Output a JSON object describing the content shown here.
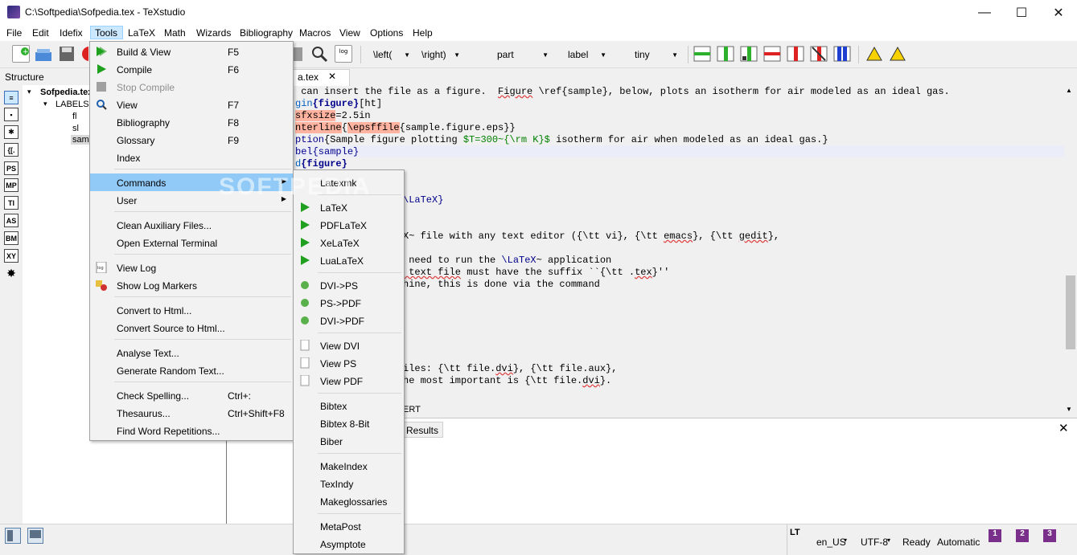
{
  "window": {
    "title": "C:\\Softpedia\\Sofpedia.tex - TeXstudio",
    "minimize": "—",
    "maximize": "☐",
    "close": "✕"
  },
  "menubar": [
    "File",
    "Edit",
    "Idefix",
    "Tools",
    "LaTeX",
    "Math",
    "Wizards",
    "Bibliography",
    "Macros",
    "View",
    "Options",
    "Help"
  ],
  "toolbar": {
    "combos": [
      "\\left(",
      "\\right)",
      "part",
      "label",
      "tiny"
    ]
  },
  "structure": {
    "header": "Structure",
    "sidebar_icons": [
      "≡",
      "▪",
      "✱",
      "{[.",
      "PS",
      "MP",
      "TI",
      "AS",
      "BM",
      "XY",
      "✸"
    ],
    "tree": {
      "root": "Sofpedia.tex",
      "labels": "LABELS",
      "items": [
        "fl",
        "sl",
        "samp"
      ]
    }
  },
  "editor": {
    "tab_name": "Sofpedia.tex",
    "tab_visible": "a.tex",
    "tab_close": "✕",
    "watermark": "SOFTPEDIA",
    "line_frag_1": " can insert the file as a figure.  ",
    "line_frag_1b": "Figure",
    "line_frag_1c": " \\ref{sample}, below, plots an isotherm for air modeled as an ideal gas.",
    "line_frag_2a": "gin",
    "line_frag_2b": "{figure}",
    "line_frag_2c": "[ht]",
    "line_frag_3a": "sfxsize",
    "line_frag_3b": "=2.5in",
    "line_frag_4a": "nterline",
    "line_frag_4b": "{",
    "line_frag_4c": "\\epsffile",
    "line_frag_4d": "{sample.figure.eps}}",
    "line_frag_5a": "ption",
    "line_frag_5b": "{Sample figure plotting ",
    "line_frag_5c": "$T=300~{\\rm K}$",
    "line_frag_5d": " isotherm for air when modeled as an ideal gas.}",
    "line_frag_6a": "bel",
    "line_frag_6b": "{sample}",
    "line_frag_7a": "d",
    "line_frag_7b": "{figure}",
    "line_frag_8": "\\LaTeX}",
    "line_frag_9a": "X~ file with any text editor ({\\tt vi}, {\\tt ",
    "line_frag_9b": "emacs",
    "line_frag_9c": "}, {\\tt ",
    "line_frag_9d": "gedit",
    "line_frag_9e": "},",
    "line_frag_10a": " need to run the ",
    "line_frag_10b": "\\LaTeX",
    "line_frag_10c": "~ application",
    "line_frag_11a": " text file",
    "line_frag_11b": " must have the suffix ``{\\tt .",
    "line_frag_11c": "tex",
    "line_frag_11d": "}''",
    "line_frag_12": "hine, this is done via the command",
    "line_frag_13a": "iles: {\\tt file.",
    "line_frag_13b": "dvi",
    "line_frag_13c": "}, {\\tt file.aux},",
    "line_frag_14a": "he most important is {\\tt file.",
    "line_frag_14b": "dvi",
    "line_frag_14c": "}.",
    "line_frag_15": "ERT"
  },
  "bottom": {
    "results_tab": "Results",
    "close": "✕"
  },
  "statusbar": {
    "lt": "LT",
    "language": "en_US",
    "encoding": "UTF-8",
    "status": "Ready",
    "mode": "Automatic"
  },
  "tools_menu": [
    {
      "label": "Build & View",
      "shortcut": "F5"
    },
    {
      "label": "Compile",
      "shortcut": "F6"
    },
    {
      "label": "Stop Compile",
      "shortcut": ""
    },
    {
      "label": "View",
      "shortcut": "F7"
    },
    {
      "label": "Bibliography",
      "shortcut": "F8"
    },
    {
      "label": "Glossary",
      "shortcut": "F9"
    },
    {
      "label": "Index",
      "shortcut": ""
    },
    {
      "label": "Commands",
      "shortcut": ""
    },
    {
      "label": "User",
      "shortcut": ""
    },
    {
      "label": "Clean Auxiliary Files...",
      "shortcut": ""
    },
    {
      "label": "Open External Terminal",
      "shortcut": ""
    },
    {
      "label": "View Log",
      "shortcut": ""
    },
    {
      "label": "Show Log Markers",
      "shortcut": ""
    },
    {
      "label": "Convert to Html...",
      "shortcut": ""
    },
    {
      "label": "Convert Source to Html...",
      "shortcut": ""
    },
    {
      "label": "Analyse Text...",
      "shortcut": ""
    },
    {
      "label": "Generate Random Text...",
      "shortcut": ""
    },
    {
      "label": "Check Spelling...",
      "shortcut": "Ctrl+:"
    },
    {
      "label": "Thesaurus...",
      "shortcut": "Ctrl+Shift+F8"
    },
    {
      "label": "Find Word Repetitions...",
      "shortcut": ""
    }
  ],
  "commands_menu": [
    "Latexmk",
    "LaTeX",
    "PDFLaTeX",
    "XeLaTeX",
    "LuaLaTeX",
    "DVI->PS",
    "PS->PDF",
    "DVI->PDF",
    "View DVI",
    "View PS",
    "View PDF",
    "Bibtex",
    "Bibtex 8-Bit",
    "Biber",
    "MakeIndex",
    "TexIndy",
    "Makeglossaries",
    "MetaPost",
    "Asymptote"
  ],
  "colors": {
    "menu_hover": "#91c9f7",
    "menu_active": "#cce8ff",
    "highlight": "#ffb3a0",
    "keyword": "#00008b",
    "math": "#008000"
  }
}
